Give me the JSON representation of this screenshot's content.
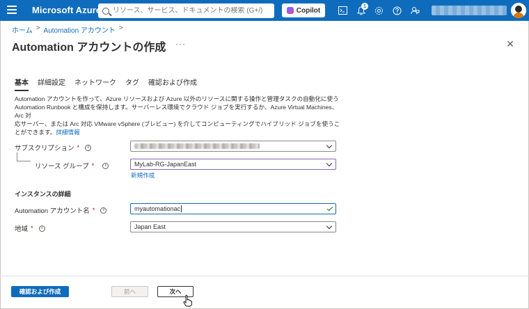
{
  "topbar": {
    "brand": "Microsoft Azure",
    "search_placeholder": "リソース、サービス、ドキュメントの検索 (G+/)",
    "copilot_label": "Copilot",
    "notification_count": "1"
  },
  "breadcrumb": {
    "items": [
      "ホーム",
      "Automation アカウント"
    ],
    "separator": ">"
  },
  "page": {
    "title": "Automation アカウントの作成",
    "more": "···",
    "close": "✕"
  },
  "tabs": [
    {
      "label": "基本",
      "active": true
    },
    {
      "label": "詳細設定",
      "active": false
    },
    {
      "label": "ネットワーク",
      "active": false
    },
    {
      "label": "タグ",
      "active": false
    },
    {
      "label": "確認および作成",
      "active": false
    }
  ],
  "description": {
    "line1": "Automation アカウントを作って、Azure リソースおよび Azure 以外のリソースに関する操作と管理タスクの自動化に使う",
    "line2": "Automation Runbook と構成を保持します。サーバーレス環境でクラウド ジョブを実行するか、Azure Virtual Machines、Arc 対",
    "line3": "応サーバー、または Arc 対応 VMware vSphere (プレビュー) を介してコンピューティングでハイブリッド ジョブを使うことができます。",
    "link": "詳細情報"
  },
  "form": {
    "subscription_label": "サブスクリプション",
    "resource_group_label": "リソース グループ",
    "resource_group_value": "MyLab-RG-JapanEast",
    "create_new_link": "新規作成",
    "instance_section": "インスタンスの詳細",
    "account_name_label": "Automation アカウント名",
    "account_name_value": "myautomationac",
    "region_label": "地域",
    "region_value": "Japan East",
    "required_mark": "*",
    "info_mark": "i"
  },
  "footer": {
    "review_create": "確認および作成",
    "previous": "前へ",
    "next": "次へ"
  },
  "colors": {
    "accent": "#0f6cbd",
    "required": "#a4262c",
    "valid": "#107c10"
  }
}
